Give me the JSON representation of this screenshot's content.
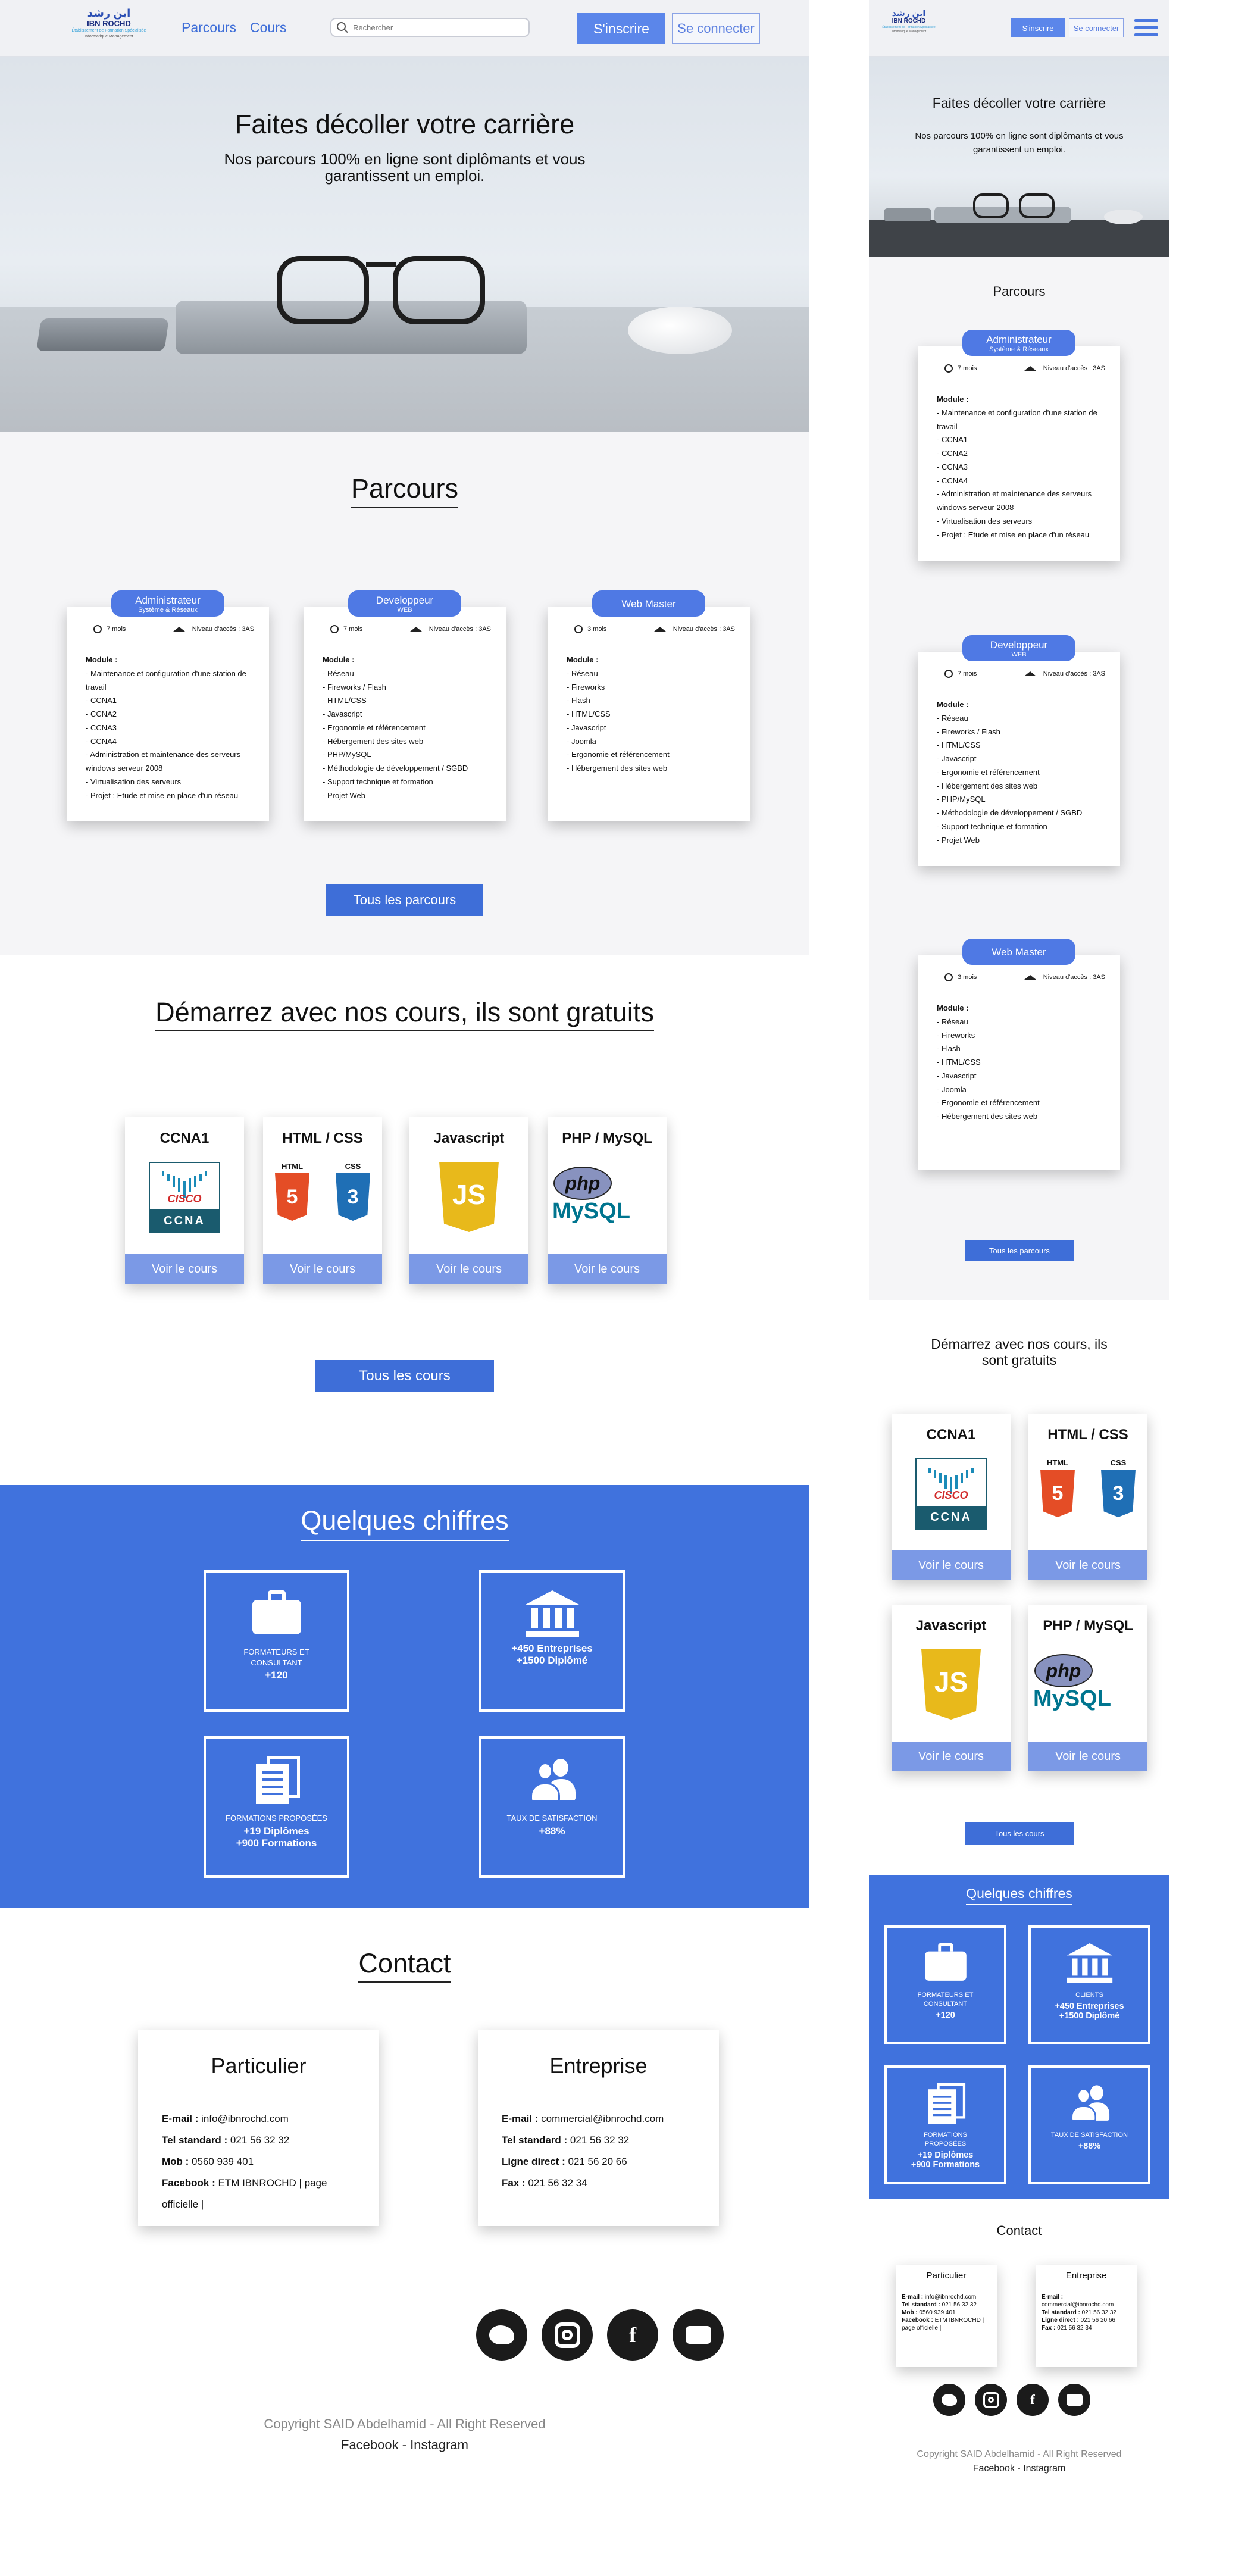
{
  "header": {
    "logo_ar": "ابن رشد",
    "logo_name": "IBN ROCHD",
    "logo_tag1": "Établissement de Formation Spécialisée",
    "logo_tag2": "Informatique Management",
    "nav": [
      "Parcours",
      "Cours"
    ],
    "search_placeholder": "Rechercher",
    "signup": "S'inscrire",
    "login": "Se connecter"
  },
  "hero": {
    "title": "Faites décoller votre carrière",
    "subtitle": "Nos parcours 100% en ligne sont diplômants et vous garantissent un emploi."
  },
  "parcours": {
    "title": "Parcours",
    "cards": [
      {
        "title": "Administrateur",
        "sub": "Système & Réseaux",
        "duration": "7 mois",
        "level": "Niveau d'accès : 3AS",
        "module_label": "Module :",
        "items": [
          "- Maintenance et configuration d'une station de travail",
          "- CCNA1",
          "- CCNA2",
          "- CCNA3",
          "- CCNA4",
          "- Administration et maintenance des serveurs windows serveur 2008",
          "- Virtualisation des serveurs",
          "- Projet : Etude et mise en place d'un réseau"
        ]
      },
      {
        "title": "Developpeur",
        "sub": "WEB",
        "duration": "7 mois",
        "level": "Niveau d'accès : 3AS",
        "module_label": "Module :",
        "items": [
          "- Réseau",
          "- Fireworks / Flash",
          "- HTML/CSS",
          "- Javascript",
          "- Ergonomie et référencement",
          "- Hébergement des sites web",
          "- PHP/MySQL",
          "- Méthodologie de développement / SGBD",
          "- Support technique et formation",
          "- Projet Web"
        ]
      },
      {
        "title": "Web Master",
        "sub": "",
        "duration": "3 mois",
        "level": "Niveau d'accès : 3AS",
        "module_label": "Module :",
        "items": [
          "- Réseau",
          "- Fireworks",
          "- Flash",
          "- HTML/CSS",
          "- Javascript",
          "- Joomla",
          "- Ergonomie et référencement",
          "- Hébergement des sites web"
        ]
      }
    ],
    "button": "Tous les parcours"
  },
  "cours": {
    "title": "Démarrez avec nos cours, ils sont gratuits",
    "cards": [
      {
        "name": "CCNA1",
        "button": "Voir le cours",
        "logo": "cisco-ccna-logo",
        "logo_text1": "CISCO",
        "logo_text2": "CCNA"
      },
      {
        "name": "HTML / CSS",
        "button": "Voir le cours",
        "logo": "html5-css3-logo",
        "logo_text1": "HTML",
        "logo_text2": "CSS"
      },
      {
        "name": "Javascript",
        "button": "Voir le cours",
        "logo": "js-logo",
        "logo_text1": "JS",
        "logo_text2": ""
      },
      {
        "name": "PHP / MySQL",
        "button": "Voir le cours",
        "logo": "php-mysql-logo",
        "logo_text1": "php",
        "logo_text2": "MySQL"
      }
    ],
    "button": "Tous les cours"
  },
  "chiffres": {
    "title": "Quelques chiffres",
    "stats": [
      {
        "icon": "briefcase-icon",
        "label": "Formateurs et consultant",
        "label_m": "Formateurs et consultant",
        "value": "+120",
        "value2": ""
      },
      {
        "icon": "institution-icon",
        "label": "",
        "label_m": "Clients",
        "value": "+450 Entreprises",
        "value2": "+1500 Diplômé"
      },
      {
        "icon": "documents-icon",
        "label": "Formations proposées",
        "label_m": "Formations proposées",
        "value": "+19 Diplômes",
        "value2": "+900 Formations"
      },
      {
        "icon": "users-icon",
        "label": "Taux de satisfaction",
        "label_m": "Taux de satisfaction",
        "value": "+88%",
        "value2": ""
      }
    ]
  },
  "contact": {
    "title": "Contact",
    "particulier": {
      "title": "Particulier",
      "rows": [
        {
          "k": "E-mail :",
          "v": " info@ibnrochd.com"
        },
        {
          "k": "Tel standard :",
          "v": " 021 56 32 32"
        },
        {
          "k": "Mob :",
          "v": " 0560 939 401"
        },
        {
          "k": "Facebook :",
          "v": " ETM IBNROCHD | page officielle |"
        }
      ]
    },
    "entreprise": {
      "title": "Entreprise",
      "rows": [
        {
          "k": "E-mail :",
          "v": " commercial@ibnrochd.com"
        },
        {
          "k": "Tel standard :",
          "v": " 021 56 32 32"
        },
        {
          "k": "Ligne direct :",
          "v": " 021 56 20 66"
        },
        {
          "k": "Fax :",
          "v": " 021 56 32 34"
        }
      ]
    }
  },
  "social": [
    "twitter-icon",
    "instagram-icon",
    "facebook-icon",
    "youtube-icon"
  ],
  "footer": {
    "copyright": "Copyright SAID Abdelhamid - All Right Reserved",
    "links": "Facebook - Instagram"
  },
  "colors": {
    "primary": "#3e6ed8",
    "button_light": "#7b99e6",
    "pill": "#4f79e4",
    "bg_light": "#f5f5f7"
  }
}
